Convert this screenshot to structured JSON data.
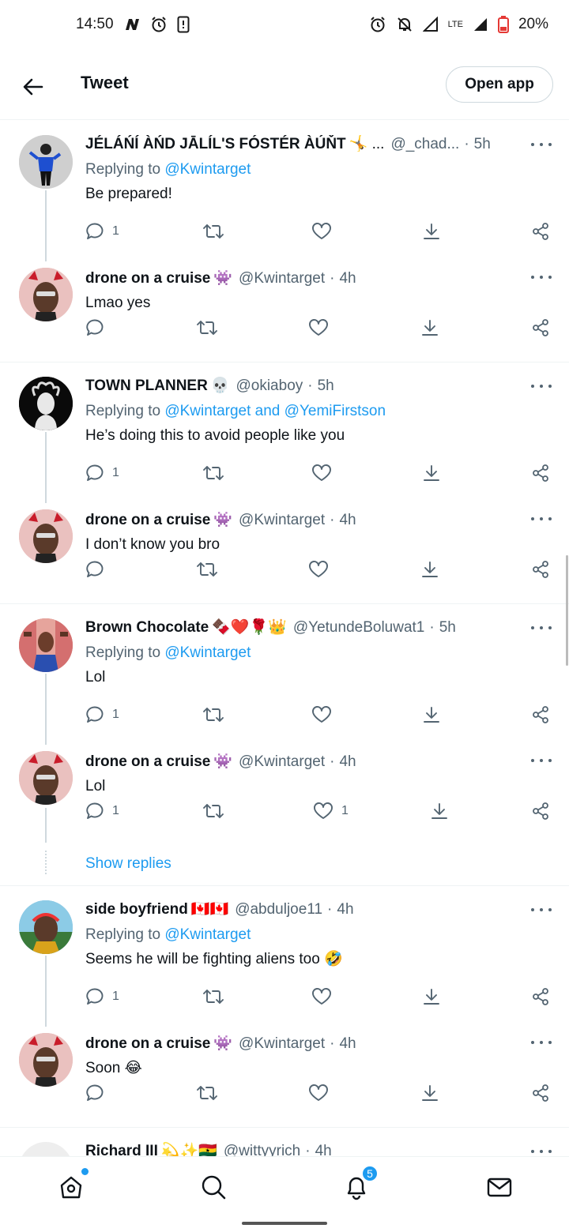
{
  "status_bar": {
    "time": "14:50",
    "network": "LTE",
    "battery": "20%"
  },
  "header": {
    "title": "Tweet",
    "open_app": "Open app"
  },
  "groups": [
    {
      "tweets": [
        {
          "name": "JÉLÁŃÍ ÀŃD JĀLÍL'S FÓSTÉR ÀÚŇT",
          "name_suffix": "🤸 ...",
          "handle": "@_chad...",
          "time": "5h",
          "replying_prefix": "Replying to",
          "replying_to": "@Kwintarget",
          "text": "Be prepared!",
          "reply_count": "1",
          "like_count": ""
        },
        {
          "name": "drone on a cruise",
          "name_suffix": "👾",
          "handle": "@Kwintarget",
          "time": "4h",
          "text": "Lmao yes",
          "reply_count": "",
          "like_count": ""
        }
      ]
    },
    {
      "tweets": [
        {
          "name": "TOWN PLANNER",
          "name_suffix": "💀",
          "handle": "@okiaboy",
          "time": "5h",
          "replying_prefix": "Replying to",
          "replying_to": "@Kwintarget and @YemiFirstson",
          "text": "He’s doing this to avoid people like you",
          "reply_count": "1",
          "like_count": ""
        },
        {
          "name": "drone on a cruise",
          "name_suffix": "👾",
          "handle": "@Kwintarget",
          "time": "4h",
          "text": "I don’t know you bro",
          "reply_count": "",
          "like_count": ""
        }
      ]
    },
    {
      "tweets": [
        {
          "name": "Brown Chocolate",
          "name_suffix": "🍫❤️🌹👑",
          "handle": "@YetundeBoluwat1",
          "time": "5h",
          "replying_prefix": "Replying to",
          "replying_to": "@Kwintarget",
          "text": "Lol",
          "reply_count": "1",
          "like_count": ""
        },
        {
          "name": "drone on a cruise",
          "name_suffix": "👾",
          "handle": "@Kwintarget",
          "time": "4h",
          "text": "Lol",
          "reply_count": "1",
          "like_count": "1"
        }
      ],
      "show_replies": "Show replies"
    },
    {
      "tweets": [
        {
          "name": "side boyfriend",
          "name_suffix": "🇨🇦🇨🇦",
          "handle": "@abduljoe11",
          "time": "4h",
          "replying_prefix": "Replying to",
          "replying_to": "@Kwintarget",
          "text": "Seems he will be fighting aliens too 🤣",
          "reply_count": "1",
          "like_count": ""
        },
        {
          "name": "drone on a cruise",
          "name_suffix": "👾",
          "handle": "@Kwintarget",
          "time": "4h",
          "text": "Soon 😂",
          "reply_count": "",
          "like_count": ""
        }
      ]
    },
    {
      "tweets": [
        {
          "name": "Richard III",
          "name_suffix": "💫✨🇬🇭",
          "handle": "@wittyyrich",
          "time": "4h"
        }
      ]
    }
  ],
  "bottom_nav": {
    "notifications_badge": "5"
  },
  "colors": {
    "accent": "#1d9bf0",
    "text_primary": "#0f1419",
    "text_secondary": "#536471",
    "divider": "#eff3f4"
  }
}
